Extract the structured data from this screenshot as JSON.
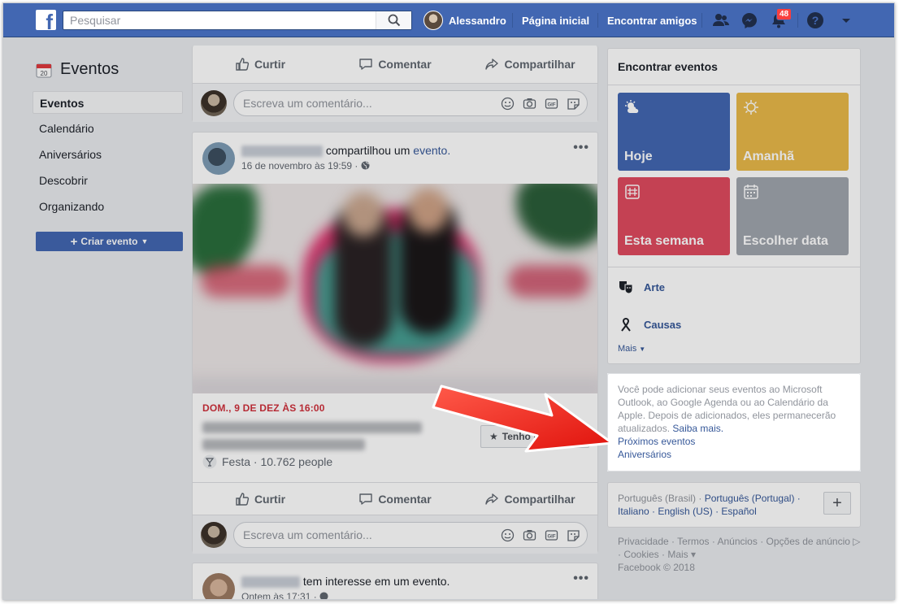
{
  "topbar": {
    "logo": "f",
    "search_placeholder": "Pesquisar",
    "user_name": "Alessandro",
    "home": "Página inicial",
    "find_friends": "Encontrar amigos",
    "notif_count": "48"
  },
  "left": {
    "title": "Eventos",
    "calendar_day": "20",
    "items": [
      "Eventos",
      "Calendário",
      "Aniversários",
      "Descobrir",
      "Organizando"
    ],
    "create_label": "Criar evento"
  },
  "feed": {
    "like": "Curtir",
    "comment": "Comentar",
    "share": "Compartilhar",
    "comment_placeholder": "Escreva um comentário...",
    "post1": {
      "action_pre": "compartilhou um",
      "action_link": "evento.",
      "time": "16 de novembro às 19:59 ·",
      "event_date": "DOM., 9 DE DEZ ÀS 16:00",
      "interest_label": "Tenho interesse",
      "category": "Festa · 10.762 people"
    },
    "post2": {
      "action": "tem interesse em um evento.",
      "time": "Ontem às 17:31 ·"
    }
  },
  "right": {
    "find_title": "Encontrar eventos",
    "tiles": [
      "Hoje",
      "Amanhã",
      "Esta semana",
      "Escolher data"
    ],
    "tile_colors": [
      "#4267b2",
      "#e9b949",
      "#e04a5f",
      "#a0a5ad"
    ],
    "categories": [
      "Arte",
      "Causas"
    ],
    "more": "Mais",
    "info_text": "Você pode adicionar seus eventos ao Microsoft Outlook, ao Google Agenda ou ao Calendário da Apple. Depois de adicionados, eles permanecerão atualizados.",
    "learn_more": "Saiba mais.",
    "upcoming": "Próximos eventos",
    "birthdays": "Aniversários",
    "lang_current": "Português (Brasil) ·",
    "lang_links": [
      "Português (Portugal) ·",
      "Italiano ·",
      "English (US) ·",
      "Español"
    ],
    "footer": "Privacidade · Termos · Anúncios · Opções de anúncio ▷ · Cookies · Mais ▾",
    "copyright": "Facebook © 2018"
  }
}
